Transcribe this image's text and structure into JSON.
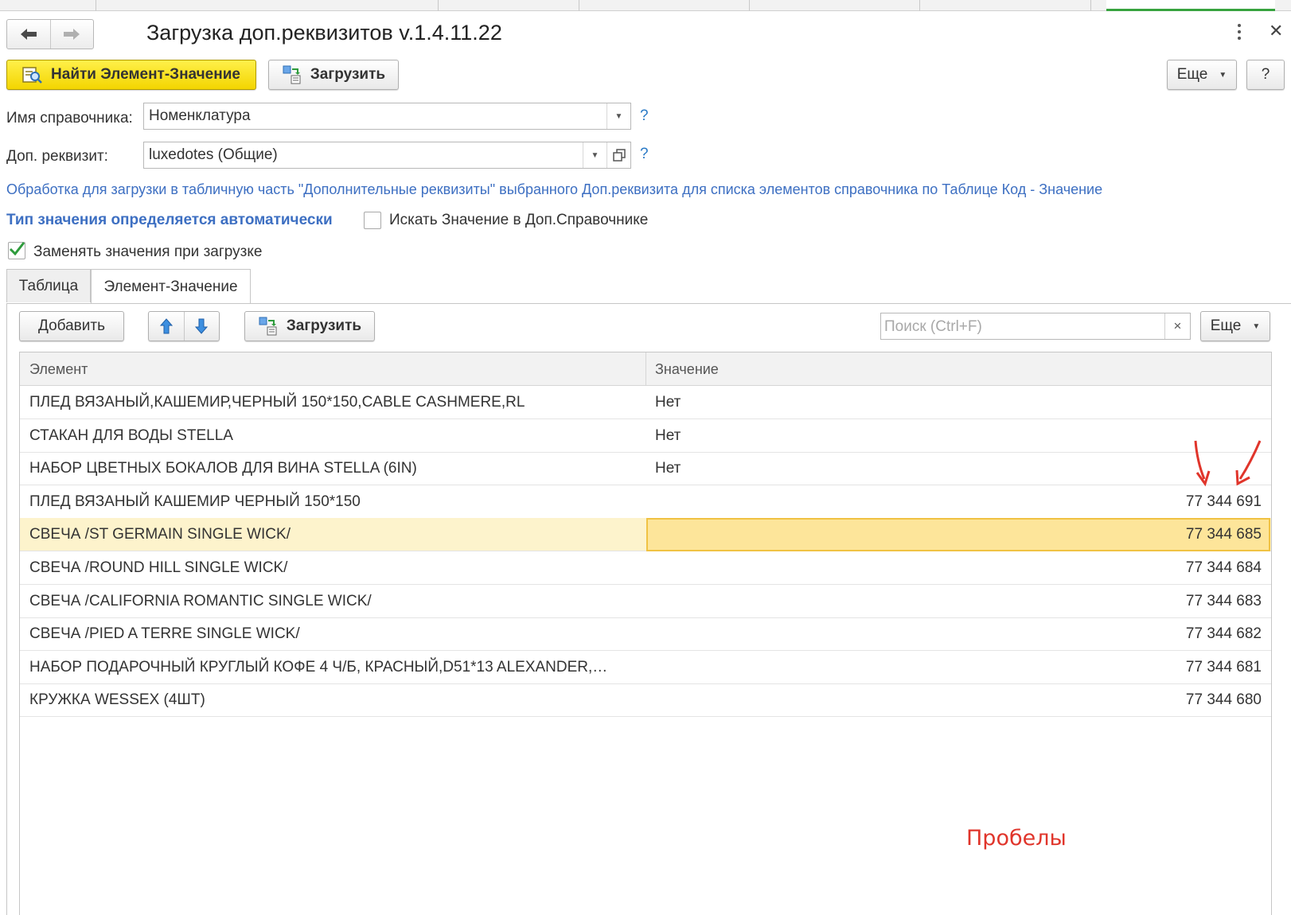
{
  "window": {
    "title": "Загрузка доп.реквизитов v.1.4.11.22"
  },
  "toolbar": {
    "find_label": "Найти Элемент-Значение",
    "load_label": "Загрузить",
    "more_label": "Еще",
    "help_label": "?"
  },
  "form": {
    "catalog_label": "Имя справочника:",
    "catalog_value": "Номенклатура",
    "attr_label": "Доп. реквизит:",
    "attr_value": "luxedotes (Общие)",
    "help_mark": "?",
    "info_text": "Обработка для загрузки в табличную часть \"Дополнительные реквизиты\" выбранного Доп.реквизита для списка элементов справочника по Таблице Код - Значение",
    "auto_type_text": "Тип значения определяется автоматически",
    "search_in_catalog_label": "Искать Значение в Доп.Справочнике",
    "search_in_catalog_checked": false,
    "replace_values_label": "Заменять значения при загрузке",
    "replace_values_checked": true
  },
  "tabs": [
    {
      "label": "Таблица",
      "active": false
    },
    {
      "label": "Элемент-Значение",
      "active": true
    }
  ],
  "panel": {
    "add_label": "Добавить",
    "load_label": "Загрузить",
    "search_placeholder": "Поиск (Ctrl+F)",
    "clear_label": "×",
    "more_label": "Еще"
  },
  "table": {
    "columns": [
      "Элемент",
      "Значение"
    ],
    "rows": [
      {
        "element": "ПЛЕД ВЯЗАНЫЙ,КАШЕМИР,ЧЕРНЫЙ 150*150,CABLE CASHMERE,RL",
        "value": "Нет",
        "numeric": false,
        "selected": false
      },
      {
        "element": "СТАКАН ДЛЯ ВОДЫ STELLA",
        "value": "Нет",
        "numeric": false,
        "selected": false
      },
      {
        "element": "НАБОР ЦВЕТНЫХ БОКАЛОВ ДЛЯ ВИНА STELLA (6IN)",
        "value": "Нет",
        "numeric": false,
        "selected": false
      },
      {
        "element": "ПЛЕД ВЯЗАНЫЙ КАШЕМИР ЧЕРНЫЙ 150*150",
        "value": "77 344 691",
        "numeric": true,
        "selected": false
      },
      {
        "element": "СВЕЧА /ST GERMAIN SINGLE WICK/",
        "value": "77 344 685",
        "numeric": true,
        "selected": true
      },
      {
        "element": "СВЕЧА /ROUND HILL SINGLE WICK/",
        "value": "77 344 684",
        "numeric": true,
        "selected": false
      },
      {
        "element": "СВЕЧА /CALIFORNIA ROMANTIC SINGLE WICK/",
        "value": "77 344 683",
        "numeric": true,
        "selected": false
      },
      {
        "element": "СВЕЧА /PIED A TERRE SINGLE WICK/",
        "value": "77 344 682",
        "numeric": true,
        "selected": false
      },
      {
        "element": "НАБОР ПОДАРОЧНЫЙ КРУГЛЫЙ КОФЕ 4 Ч/Б, КРАСНЫЙ,D51*13 ALEXANDER,…",
        "value": "77 344 681",
        "numeric": true,
        "selected": false
      },
      {
        "element": "КРУЖКА WESSEX (4ШТ)",
        "value": "77 344 680",
        "numeric": true,
        "selected": false
      }
    ]
  },
  "annotation": {
    "text": "Пробелы",
    "color": "#e0352b"
  },
  "colors": {
    "accent_yellow": "#f3d500",
    "link_blue": "#3d6fc2",
    "active_tab_green": "#37a33f",
    "selected_row": "#fdf3cc",
    "selected_cell": "#fde59a"
  }
}
